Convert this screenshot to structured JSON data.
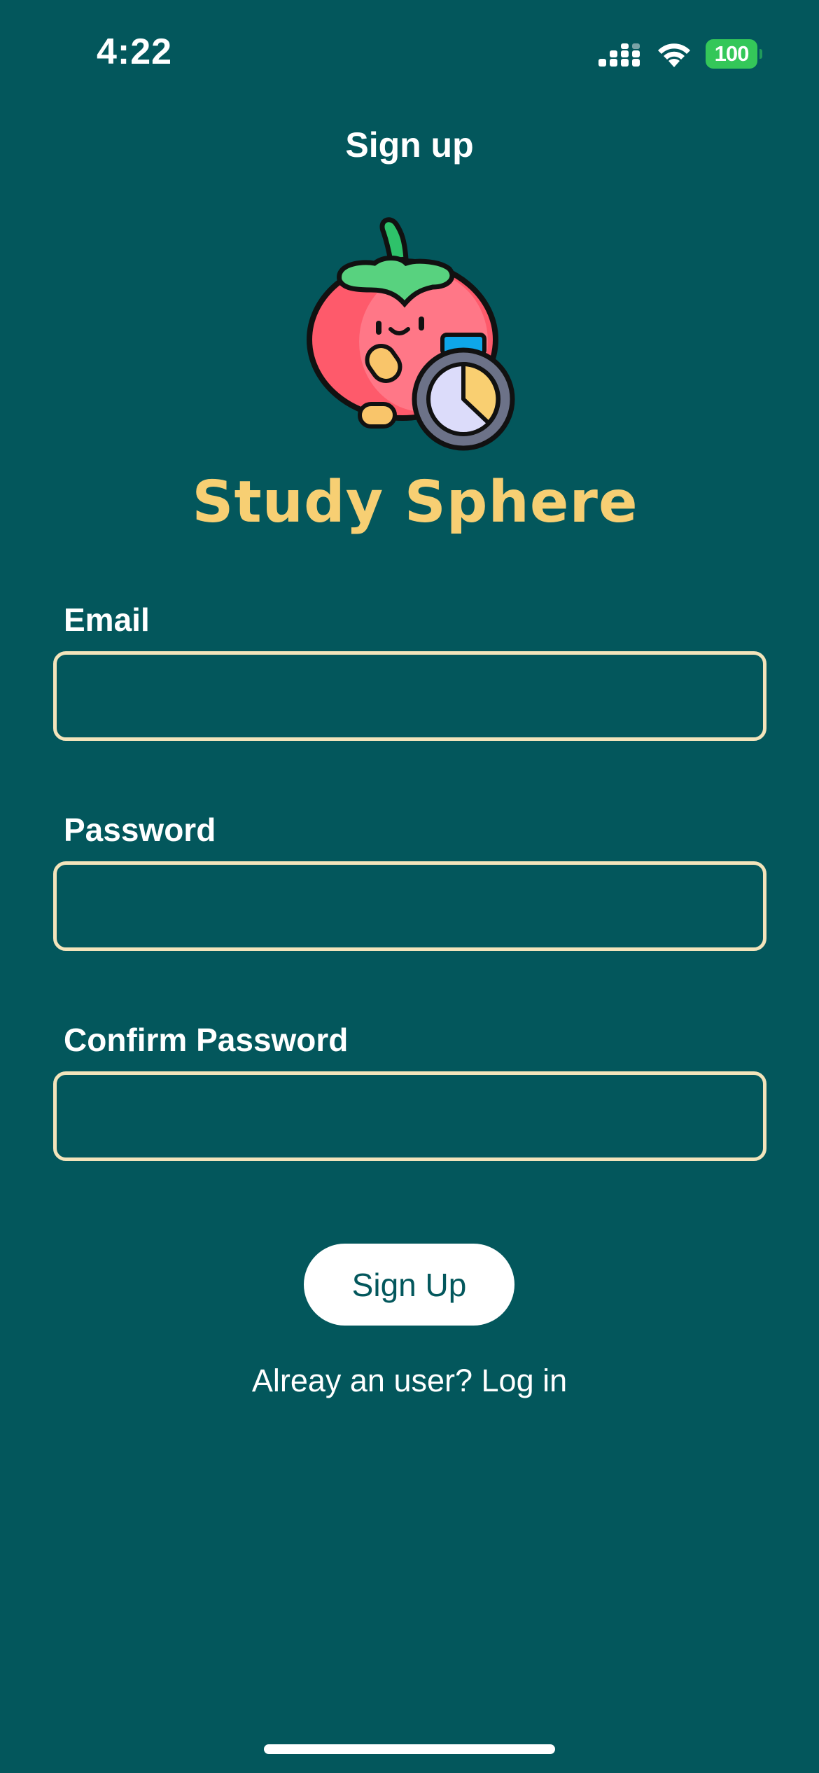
{
  "status_bar": {
    "time": "4:22",
    "battery_level": "100",
    "battery_color": "#34c759",
    "icons": [
      "signal-icon",
      "wifi-icon",
      "battery-icon"
    ]
  },
  "header": {
    "title": "Sign up"
  },
  "brand": {
    "name": "Study Sphere",
    "logo_icon": "tomato-timer-icon",
    "accent_color": "#f7cf73"
  },
  "form": {
    "email_label": "Email",
    "email_value": "",
    "password_label": "Password",
    "password_value": "",
    "confirm_password_label": "Confirm Password",
    "confirm_password_value": "",
    "submit_label": "Sign Up",
    "login_prompt": "Alreay an user? Log in"
  },
  "theme": {
    "background": "#03575c",
    "input_border": "#f3e4bb"
  }
}
